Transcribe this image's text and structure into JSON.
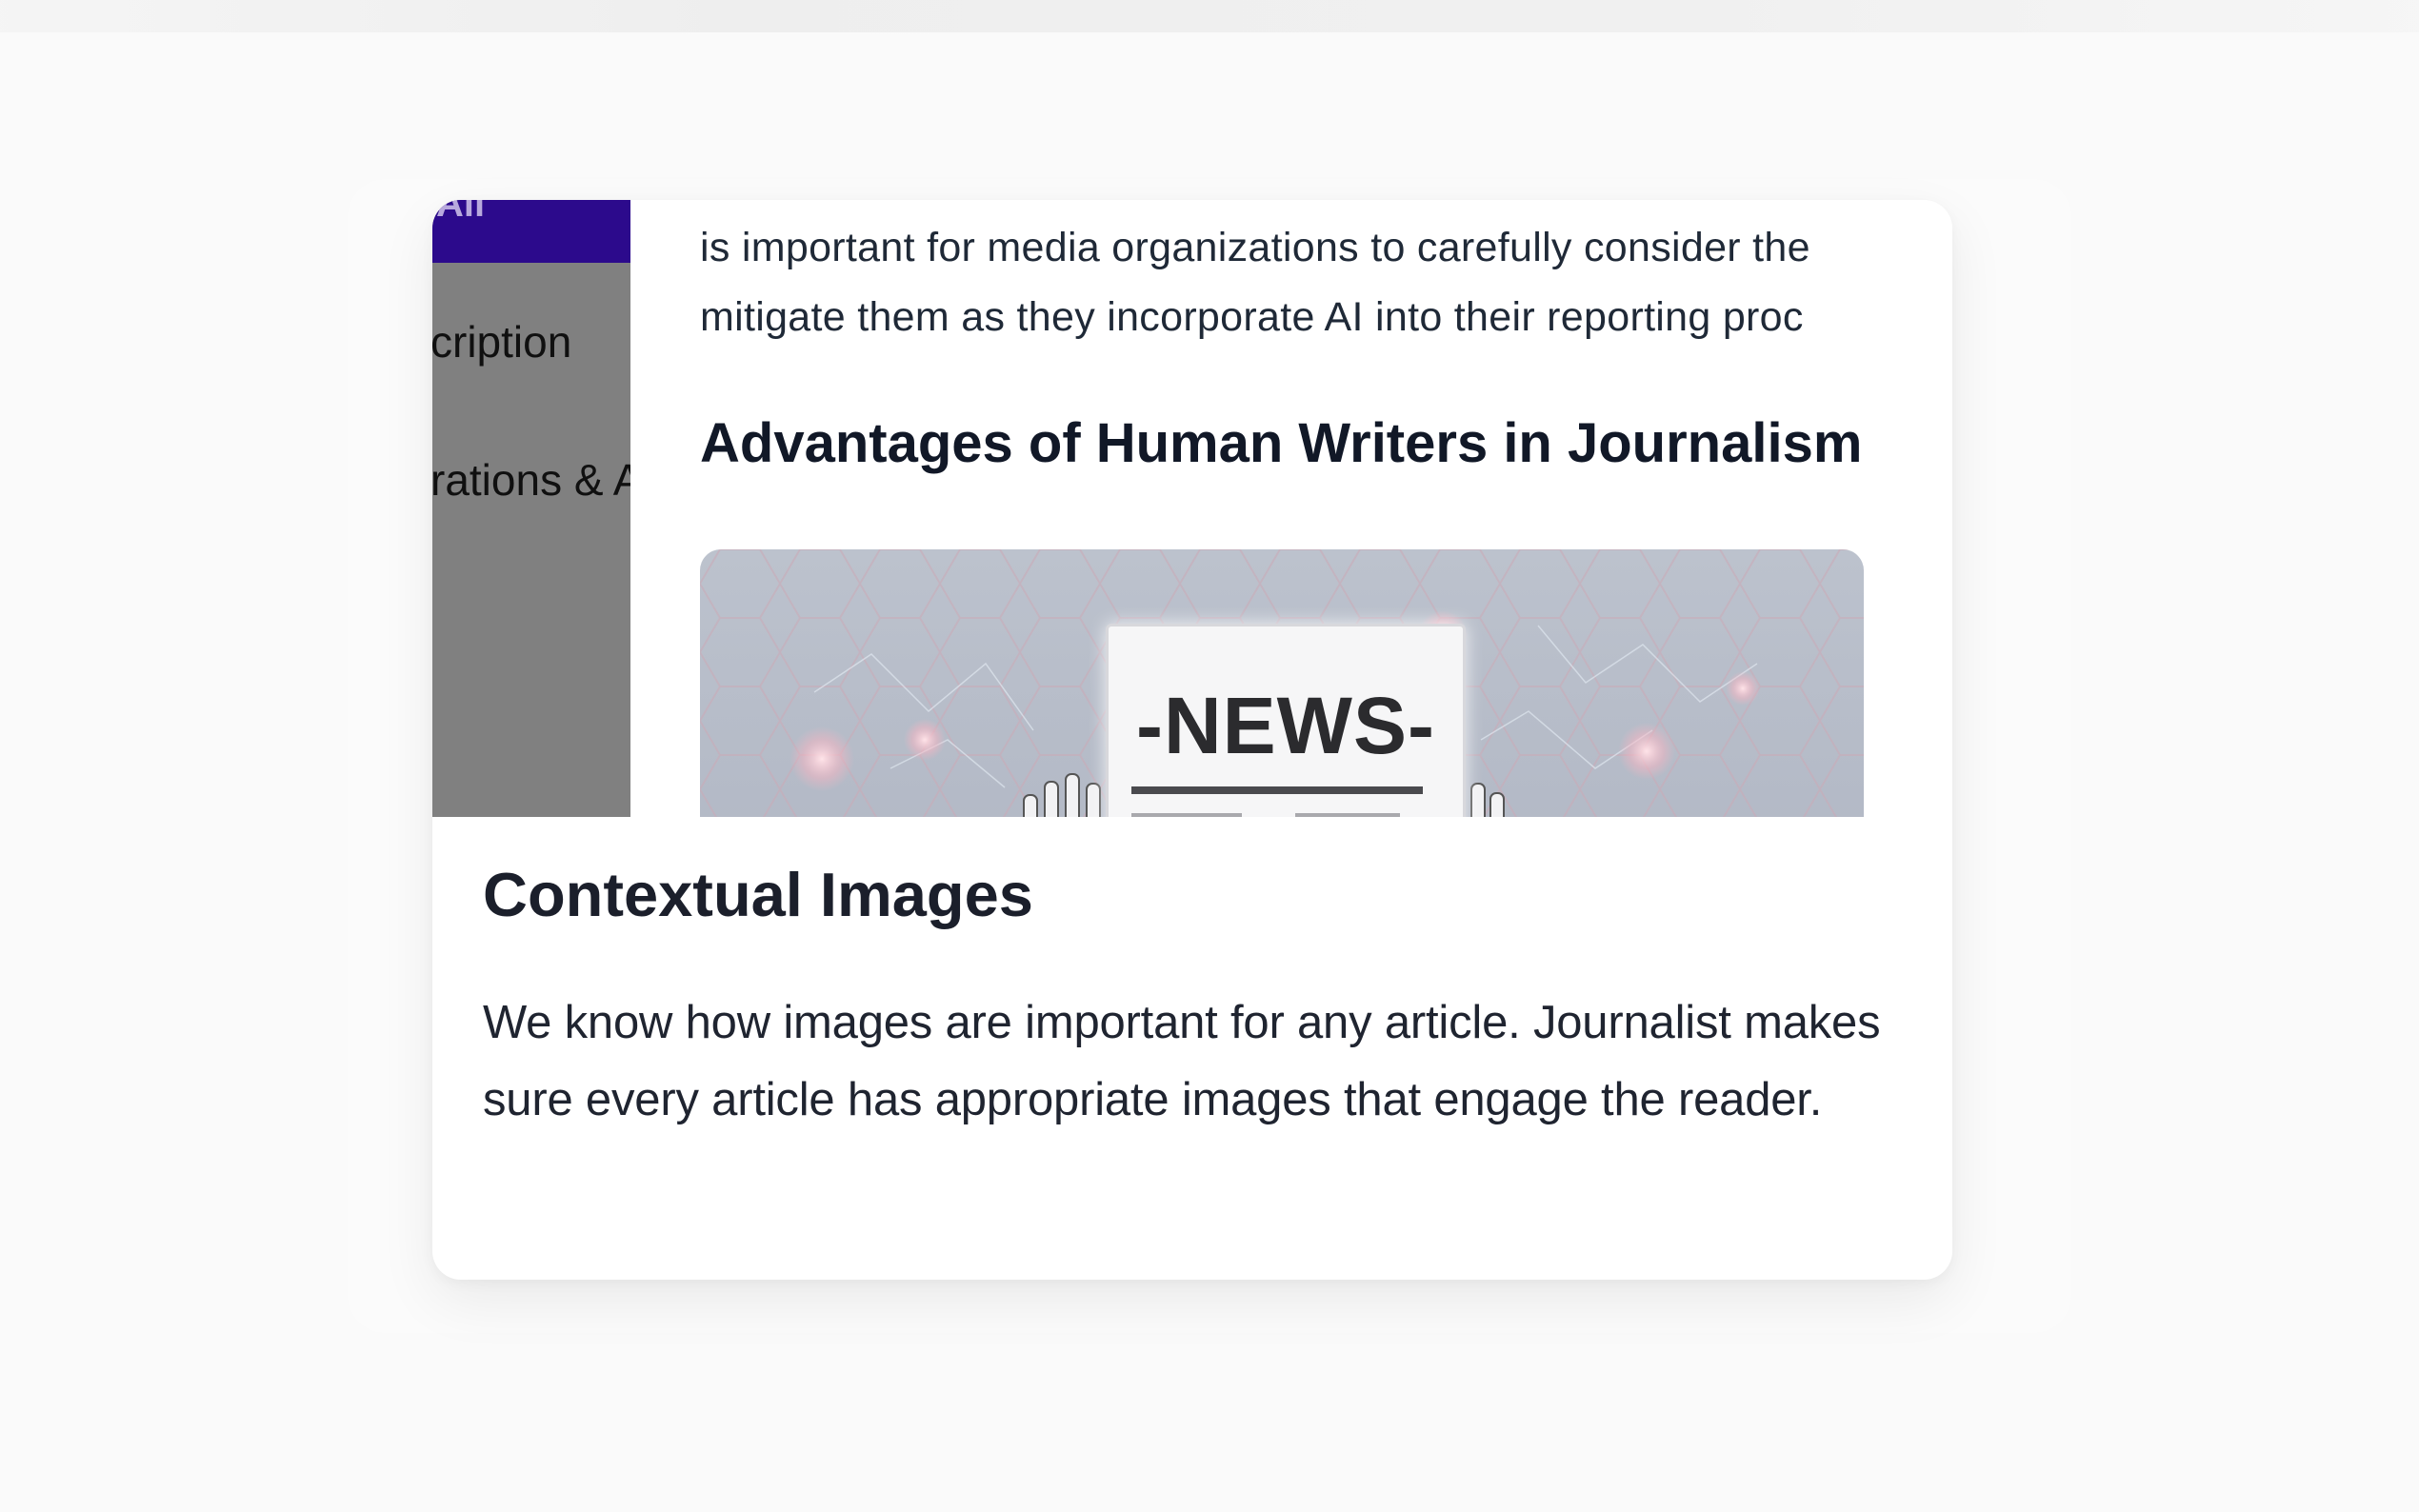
{
  "side_panel": {
    "active_item": "All",
    "items": [
      "cription",
      "rations & A"
    ]
  },
  "article": {
    "paragraph_lines": [
      "is important for media organizations to carefully consider the",
      "mitigate them as they incorporate AI into their reporting proc"
    ],
    "heading": "Advantages of Human Writers in Journalism",
    "image_label": "-NEWS-"
  },
  "feature": {
    "title": "Contextual Images",
    "description": "We know how images are important for any article. Journalist makes sure every article has appropriate images that engage the reader."
  },
  "colors": {
    "accent_purple": "#2c0a8c",
    "side_panel_gray": "#808080",
    "heading_text": "#1b1f2b"
  }
}
